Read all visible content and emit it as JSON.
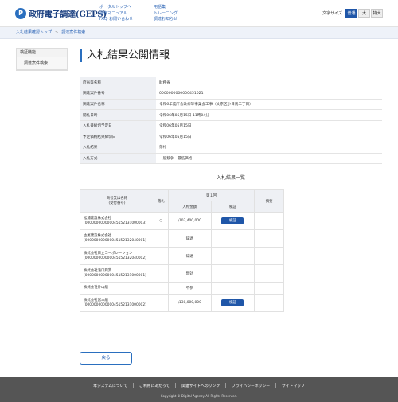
{
  "header": {
    "logo_mark": "P",
    "logo_text": "政府電子調達(GEPS)",
    "links_col1": [
      "ポータルトップへ",
      "操作マニュアル",
      "FAQ･お問い合わせ"
    ],
    "links_col2": [
      "用語集",
      "トレーニング",
      "調達お知らせ"
    ],
    "font_size_label": "文字サイズ",
    "font_sizes": [
      "普通",
      "大",
      "特大"
    ],
    "font_size_selected": "普通"
  },
  "breadcrumb": [
    "入札結果確認トップ",
    "調達案件検索"
  ],
  "sidebar": {
    "heading": "検証機能",
    "items": [
      "調達案件検索"
    ]
  },
  "page_title": "入札結果公開情報",
  "info_rows": [
    {
      "label": "府省等名称",
      "value": "財務省"
    },
    {
      "label": "調達案件番号",
      "value": "0000000000000451021"
    },
    {
      "label": "調達案件名称",
      "value": "令和6年度庁舎改修等事業会工事（文京区小日向二丁目）"
    },
    {
      "label": "開札日時",
      "value": "令和06年05月15日 11時04分"
    },
    {
      "label": "入札書締切予定日",
      "value": "令和06年05月15日"
    },
    {
      "label": "予定価格結果締切日",
      "value": "令和06年05月15日"
    },
    {
      "label": "入札結果",
      "value": "落札"
    },
    {
      "label": "入札方式",
      "value": "一般競争・最低価格"
    }
  ],
  "results": {
    "title": "入札結果一覧",
    "headers": {
      "company": "商号又は名称\n(受付番号)",
      "winner": "落札",
      "round": "第１回",
      "amount": "入札金額",
      "detail": "検証",
      "note": "摘要"
    },
    "button_label": "検証",
    "rows": [
      {
        "name": "松浦建設株式会社",
        "number": "(000000000000045152131000003)",
        "winner": "○",
        "amount": "\\103,400,000",
        "button": true
      },
      {
        "name": "古尾建設株式会社",
        "number": "(000000000000045152132040001)",
        "winner": "",
        "amount": "辞退",
        "button": false
      },
      {
        "name": "株式会社日立コーポレーション",
        "number": "(000000000000045152132040002)",
        "winner": "",
        "amount": "辞退",
        "button": false
      },
      {
        "name": "株式会社滝口興業",
        "number": "(000000000000045152131000001)",
        "winner": "",
        "amount": "無効",
        "button": false
      },
      {
        "name": "株式会社片山組",
        "number": "",
        "winner": "",
        "amount": "不参",
        "button": false
      },
      {
        "name": "株式会社富本組",
        "number": "(000000000000045152131000002)",
        "winner": "",
        "amount": "\\130,000,000",
        "button": true
      }
    ]
  },
  "back_button": "戻る",
  "footer": {
    "links": [
      "本システムについて",
      "ご利用にあたって",
      "関連サイトへのリンク",
      "プライバシーポリシー",
      "サイトマップ"
    ],
    "copyright": "Copyright © Digital Agency All Rights Reserved."
  }
}
